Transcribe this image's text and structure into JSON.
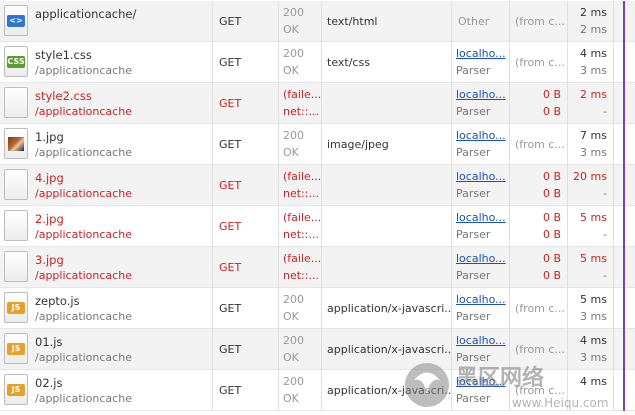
{
  "requests": [
    {
      "icon": "html-file-icon",
      "icon_class": "html",
      "badge": "<>",
      "name": "applicationcache/",
      "path": "",
      "method": "GET",
      "status_code": "200",
      "status_text": "OK",
      "type": "text/html",
      "initiator": "Other",
      "initiator_sub": "",
      "initiator_link": false,
      "size": "(from c...",
      "size2": "",
      "time": "2 ms",
      "latency": "2 ms",
      "fail": false
    },
    {
      "icon": "css-file-icon",
      "icon_class": "css",
      "badge": "CSS",
      "name": "style1.css",
      "path": "/applicationcache",
      "method": "GET",
      "status_code": "200",
      "status_text": "OK",
      "type": "text/css",
      "initiator": "localho...",
      "initiator_sub": "Parser",
      "initiator_link": true,
      "size": "(from c...",
      "size2": "",
      "time": "4 ms",
      "latency": "3 ms",
      "fail": false
    },
    {
      "icon": "blank-file-icon",
      "icon_class": "blank",
      "badge": "",
      "name": "style2.css",
      "path": "/applicationcache",
      "method": "GET",
      "status_code": "(faile...",
      "status_text": "net::...",
      "type": "",
      "initiator": "localho...",
      "initiator_sub": "Parser",
      "initiator_link": true,
      "size": "0 B",
      "size2": "0 B",
      "time": "2 ms",
      "latency": "-",
      "fail": true
    },
    {
      "icon": "image-file-icon",
      "icon_class": "img",
      "badge": "",
      "name": "1.jpg",
      "path": "/applicationcache",
      "method": "GET",
      "status_code": "200",
      "status_text": "OK",
      "type": "image/jpeg",
      "initiator": "localho...",
      "initiator_sub": "Parser",
      "initiator_link": true,
      "size": "(from c...",
      "size2": "",
      "time": "7 ms",
      "latency": "3 ms",
      "fail": false
    },
    {
      "icon": "blank-file-icon",
      "icon_class": "blank",
      "badge": "",
      "name": "4.jpg",
      "path": "/applicationcache",
      "method": "GET",
      "status_code": "(faile...",
      "status_text": "net::...",
      "type": "",
      "initiator": "localho...",
      "initiator_sub": "Parser",
      "initiator_link": true,
      "size": "0 B",
      "size2": "0 B",
      "time": "20 ms",
      "latency": "-",
      "fail": true
    },
    {
      "icon": "blank-file-icon",
      "icon_class": "blank",
      "badge": "",
      "name": "2.jpg",
      "path": "/applicationcache",
      "method": "GET",
      "status_code": "(faile...",
      "status_text": "net::...",
      "type": "",
      "initiator": "localho...",
      "initiator_sub": "Parser",
      "initiator_link": true,
      "size": "0 B",
      "size2": "0 B",
      "time": "5 ms",
      "latency": "-",
      "fail": true
    },
    {
      "icon": "blank-file-icon",
      "icon_class": "blank",
      "badge": "",
      "name": "3.jpg",
      "path": "/applicationcache",
      "method": "GET",
      "status_code": "(faile...",
      "status_text": "net::...",
      "type": "",
      "initiator": "localho...",
      "initiator_sub": "Parser",
      "initiator_link": true,
      "size": "0 B",
      "size2": "0 B",
      "time": "5 ms",
      "latency": "-",
      "fail": true
    },
    {
      "icon": "js-file-icon",
      "icon_class": "js",
      "badge": "JS",
      "name": "zepto.js",
      "path": "/applicationcache",
      "method": "GET",
      "status_code": "200",
      "status_text": "OK",
      "type": "application/x-javascri...",
      "initiator": "localho...",
      "initiator_sub": "Parser",
      "initiator_link": true,
      "size": "(from c...",
      "size2": "",
      "time": "5 ms",
      "latency": "3 ms",
      "fail": false
    },
    {
      "icon": "js-file-icon",
      "icon_class": "js",
      "badge": "JS",
      "name": "01.js",
      "path": "/applicationcache",
      "method": "GET",
      "status_code": "200",
      "status_text": "OK",
      "type": "application/x-javascri...",
      "initiator": "localho...",
      "initiator_sub": "Parser",
      "initiator_link": true,
      "size": "(from c...",
      "size2": "",
      "time": "4 ms",
      "latency": "3 ms",
      "fail": false
    },
    {
      "icon": "js-file-icon",
      "icon_class": "js",
      "badge": "JS",
      "name": "02.js",
      "path": "/applicationcache",
      "method": "GET",
      "status_code": "200",
      "status_text": "OK",
      "type": "application/x-javascri...",
      "initiator": "localho...",
      "initiator_sub": "Parser",
      "initiator_link": true,
      "size": "(from c...",
      "size2": "",
      "time": "4 ms",
      "latency": "",
      "fail": false
    }
  ],
  "watermark": {
    "brand": "黑区网络",
    "url": "www.Heiqu.com"
  },
  "colors": {
    "error": "#cc2222",
    "link": "#1a4fc1",
    "waterfall": "#7d3fb5",
    "row_alt": "#f3f3f3"
  }
}
